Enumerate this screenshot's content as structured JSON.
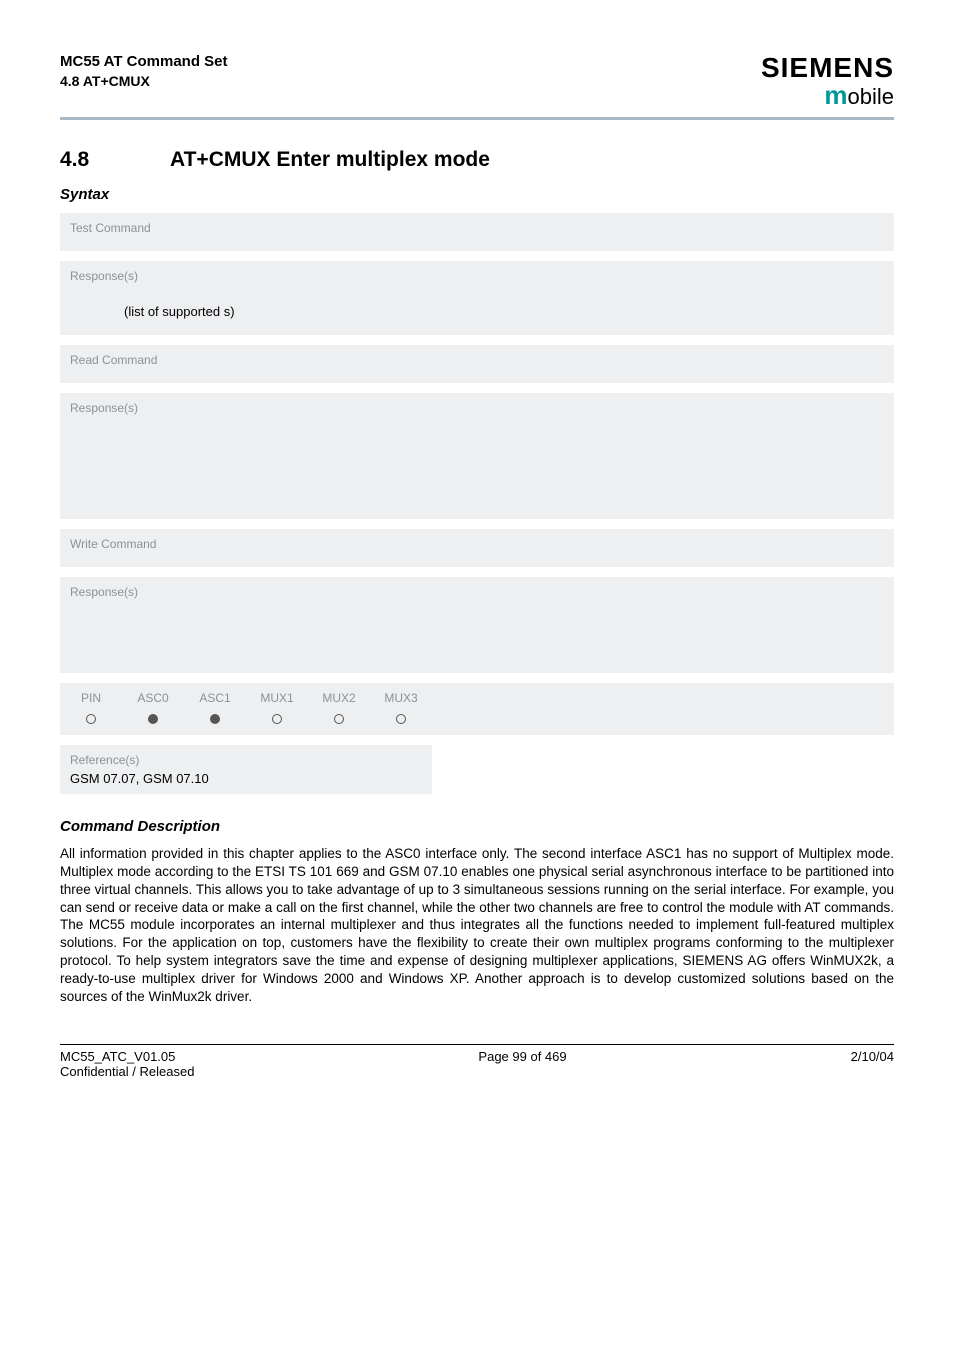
{
  "header": {
    "title": "MC55 AT Command Set",
    "subtitle": "4.8 AT+CMUX",
    "logo_top": "SIEMENS",
    "logo_bottom_m": "m",
    "logo_bottom_rest": "obile"
  },
  "section": {
    "number": "4.8",
    "title": "AT+CMUX   Enter multiplex mode"
  },
  "syntax_label": "Syntax",
  "blocks": {
    "test": {
      "label": "Test Command",
      "content": ""
    },
    "test_resp": {
      "label": "Response(s)",
      "content": "(list of supported           s)"
    },
    "read": {
      "label": "Read Command",
      "content": ""
    },
    "read_resp": {
      "label": "Response(s)",
      "content": ""
    },
    "write": {
      "label": "Write Command",
      "content": ""
    },
    "write_resp": {
      "label": "Response(s)",
      "content": ""
    }
  },
  "applicability": {
    "headers": [
      "PIN",
      "ASC0",
      "ASC1",
      "MUX1",
      "MUX2",
      "MUX3"
    ],
    "values": [
      "open",
      "filled",
      "filled",
      "open",
      "open",
      "open"
    ]
  },
  "reference": {
    "label": "Reference(s)",
    "content": "GSM 07.07, GSM 07.10"
  },
  "cmd_desc_label": "Command Description",
  "body": "All information provided in this chapter applies to the ASC0 interface only. The second interface ASC1 has no support of Multiplex mode.\nMultiplex mode according to the ETSI TS 101 669 and GSM 07.10 enables one physical serial asynchronous interface to be partitioned into three virtual channels. This allows you to take advantage of up to 3 simultaneous sessions running on the serial interface. For example, you can send or receive data or make a call on the first channel, while the other two channels are free to control the module with AT commands.\nThe MC55 module incorporates an internal multiplexer and thus integrates all the functions needed to implement full-featured multiplex solutions. For the application on top, customers have the flexibility to create their own multiplex programs conforming to the multiplexer protocol. To help system integrators save the time and expense of designing multiplexer applications, SIEMENS AG offers WinMUX2k, a ready-to-use multiplex driver for Windows 2000 and Windows XP. Another approach is to develop customized solutions based on the sources of the WinMux2k driver.",
  "footer": {
    "left1": "MC55_ATC_V01.05",
    "left2": "Confidential / Released",
    "center": "Page 99 of 469",
    "right": "2/10/04"
  }
}
